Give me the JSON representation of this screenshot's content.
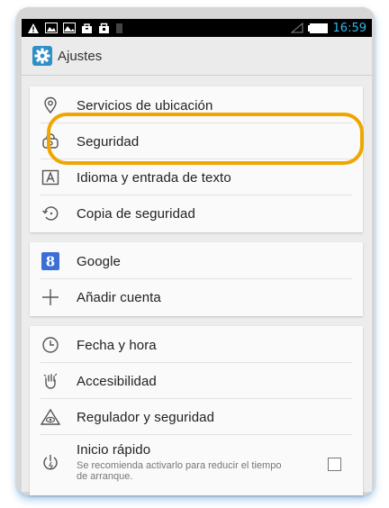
{
  "status_bar": {
    "time": "16:59"
  },
  "action_bar": {
    "title": "Ajustes"
  },
  "settings": {
    "group1": [
      {
        "label": "Servicios de ubicación",
        "icon": "location-icon"
      },
      {
        "label": "Seguridad",
        "icon": "lock-icon"
      },
      {
        "label": "Idioma y entrada de texto",
        "icon": "keyboard-a-icon"
      },
      {
        "label": "Copia de seguridad",
        "icon": "restore-icon"
      }
    ],
    "group2": [
      {
        "label": "Google",
        "icon": "google-icon"
      },
      {
        "label": "Añadir cuenta",
        "icon": "plus-icon"
      }
    ],
    "group3": [
      {
        "label": "Fecha y hora",
        "icon": "clock-icon"
      },
      {
        "label": "Accesibilidad",
        "icon": "hand-icon"
      },
      {
        "label": "Regulador y seguridad",
        "icon": "warning-eye-icon"
      },
      {
        "label": "Inicio rápido",
        "summary": "Se recomienda activarlo para reducir el tiempo de arranque.",
        "icon": "power-icon",
        "checked": false
      }
    ]
  },
  "colors": {
    "accent": "#33b5e5",
    "highlight": "#f0a500"
  }
}
